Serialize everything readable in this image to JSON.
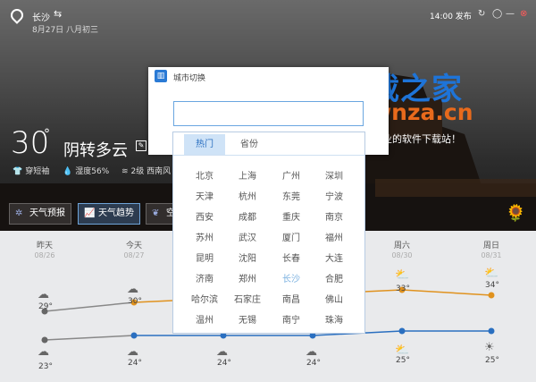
{
  "header": {
    "city": "长沙",
    "switch_icon": "switch-arrows-icon",
    "date": "8月27日 八月初三",
    "publish": "14:00 发布",
    "refresh_icon": "refresh-icon",
    "minimize_icon": "minimize-icon",
    "close_icon": "close-icon"
  },
  "current": {
    "temperature": "30",
    "degree": "°",
    "condition": "阴转多云",
    "dress": "穿短袖",
    "humidity": "湿度56%",
    "wind": "2级 西南风"
  },
  "tabs": [
    {
      "label": "天气预报",
      "icon": "gear-icon"
    },
    {
      "label": "天气趋势",
      "icon": "chart-icon"
    },
    {
      "label": "空",
      "icon": "leaf-icon"
    }
  ],
  "forecast": {
    "days": [
      {
        "day": "昨天",
        "date": "08/26",
        "high": "29°",
        "low": "23°"
      },
      {
        "day": "今天",
        "date": "08/27",
        "high": "30°",
        "low": "24°"
      },
      {
        "day": "",
        "date": "",
        "high": "",
        "low": "24°"
      },
      {
        "day": "",
        "date": "",
        "high": "",
        "low": "24°"
      },
      {
        "day": "周六",
        "date": "08/30",
        "high": "33°",
        "low": "25°"
      },
      {
        "day": "周日",
        "date": "08/31",
        "high": "34°",
        "low": "25°"
      }
    ],
    "colors": {
      "high": "#e0921e",
      "low": "#2a6fc0",
      "past": "#888888"
    }
  },
  "dialog": {
    "title": "城市切换",
    "icon": "city-building-icon",
    "input_value": "",
    "tab_hot": "热门",
    "tab_province": "省份",
    "cities": [
      [
        "北京",
        "上海",
        "广州",
        "深圳"
      ],
      [
        "天津",
        "杭州",
        "东莞",
        "宁波"
      ],
      [
        "西安",
        "成都",
        "重庆",
        "南京"
      ],
      [
        "苏州",
        "武汉",
        "厦门",
        "福州"
      ],
      [
        "昆明",
        "沈阳",
        "长春",
        "大连"
      ],
      [
        "济南",
        "郑州",
        "长沙",
        "合肥"
      ],
      [
        "哈尔滨",
        "石家庄",
        "南昌",
        "佛山"
      ],
      [
        "温州",
        "无锡",
        "南宁",
        "珠海"
      ]
    ],
    "active_city": "长沙"
  },
  "watermark": {
    "line1": "下载之家",
    "line2": "downza.cn",
    "line3": "国内最专业的软件下载站！"
  }
}
